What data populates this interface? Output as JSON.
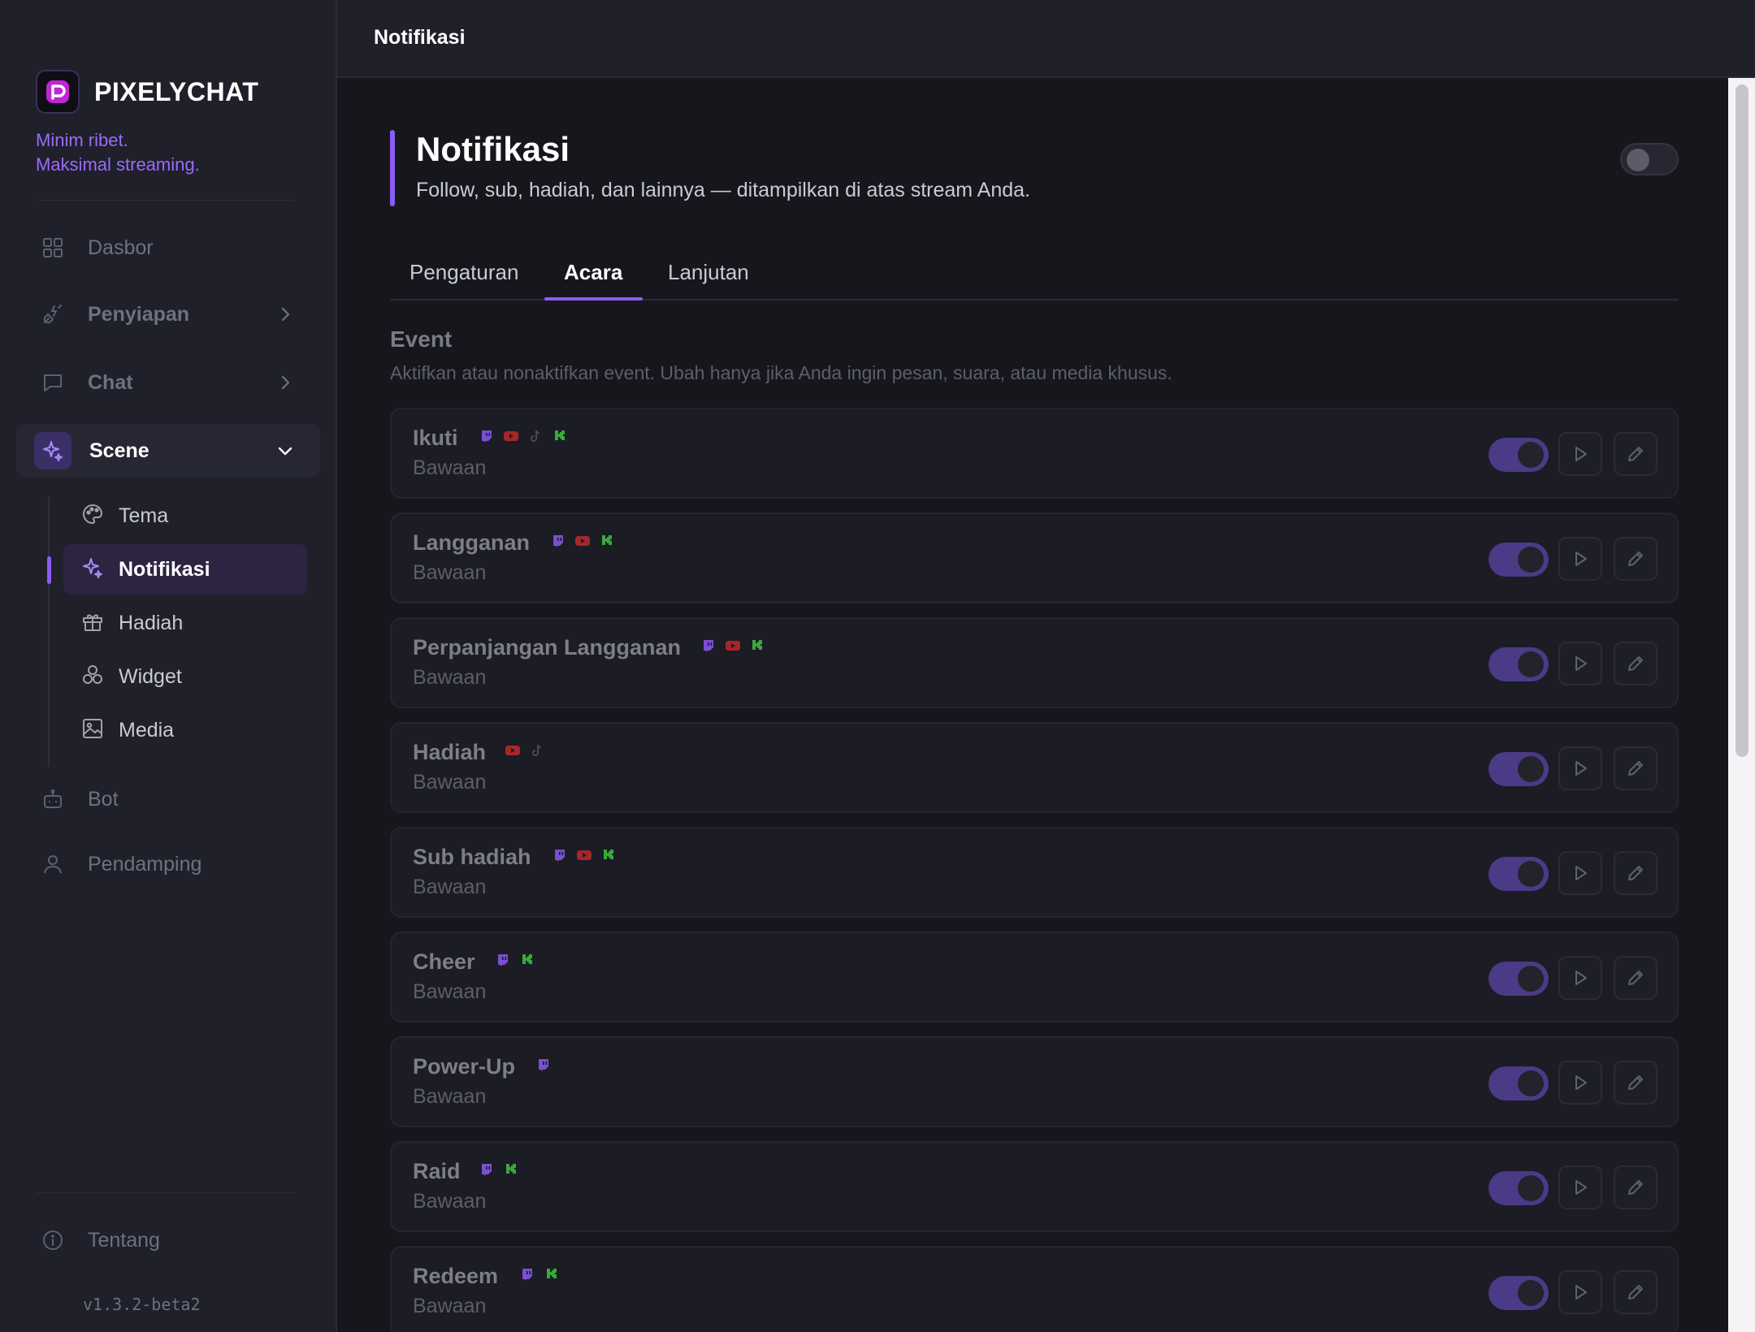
{
  "app": {
    "brand": "PIXELYCHAT",
    "tagline_line1": "Minim ribet.",
    "tagline_line2": "Maksimal streaming.",
    "version": "v1.3.2-beta2",
    "accent_color": "#8b5cf6"
  },
  "sidebar": {
    "items": [
      {
        "label": "Dasbor",
        "icon": "grid-icon"
      },
      {
        "label": "Penyiapan",
        "icon": "plug-icon",
        "has_children": true
      },
      {
        "label": "Chat",
        "icon": "chat-bubble-icon",
        "has_children": true
      },
      {
        "label": "Scene",
        "icon": "sparkle-icon",
        "expanded": true
      },
      {
        "label": "Bot",
        "icon": "robot-icon"
      },
      {
        "label": "Pendamping",
        "icon": "user-icon"
      }
    ],
    "scene_children": [
      {
        "label": "Tema",
        "icon": "palette-icon"
      },
      {
        "label": "Notifikasi",
        "icon": "sparkle-icon",
        "active": true
      },
      {
        "label": "Hadiah",
        "icon": "gift-icon"
      },
      {
        "label": "Widget",
        "icon": "shapes-icon"
      },
      {
        "label": "Media",
        "icon": "image-icon"
      }
    ],
    "footer": {
      "label": "Tentang",
      "icon": "info-icon"
    }
  },
  "topbar": {
    "title": "Notifikasi"
  },
  "page": {
    "title": "Notifikasi",
    "description": "Follow, sub, hadiah, dan lainnya — ditampilkan di atas stream Anda.",
    "enabled": false
  },
  "tabs": [
    {
      "label": "Pengaturan"
    },
    {
      "label": "Acara",
      "active": true
    },
    {
      "label": "Lanjutan"
    }
  ],
  "section": {
    "title": "Event",
    "description": "Aktifkan atau nonaktifkan event. Ubah hanya jika Anda ingin pesan, suara, atau media khusus."
  },
  "events": [
    {
      "name": "Ikuti",
      "sub": "Bawaan",
      "platforms": [
        "twitch",
        "youtube",
        "tiktok",
        "kick"
      ],
      "enabled": true
    },
    {
      "name": "Langganan",
      "sub": "Bawaan",
      "platforms": [
        "twitch",
        "youtube",
        "kick"
      ],
      "enabled": true
    },
    {
      "name": "Perpanjangan Langganan",
      "sub": "Bawaan",
      "platforms": [
        "twitch",
        "youtube",
        "kick"
      ],
      "enabled": true
    },
    {
      "name": "Hadiah",
      "sub": "Bawaan",
      "platforms": [
        "youtube",
        "tiktok"
      ],
      "enabled": true
    },
    {
      "name": "Sub hadiah",
      "sub": "Bawaan",
      "platforms": [
        "twitch",
        "youtube",
        "kick"
      ],
      "enabled": true
    },
    {
      "name": "Cheer",
      "sub": "Bawaan",
      "platforms": [
        "twitch",
        "kick"
      ],
      "enabled": true
    },
    {
      "name": "Power-Up",
      "sub": "Bawaan",
      "platforms": [
        "twitch"
      ],
      "enabled": true
    },
    {
      "name": "Raid",
      "sub": "Bawaan",
      "platforms": [
        "twitch",
        "kick"
      ],
      "enabled": true
    },
    {
      "name": "Redeem",
      "sub": "Bawaan",
      "platforms": [
        "twitch",
        "kick"
      ],
      "enabled": true
    }
  ],
  "platform_colors": {
    "twitch": "#7a4fd0",
    "youtube": "#a8262a",
    "tiktok": "#4a4a52",
    "kick": "#3aa83a"
  }
}
